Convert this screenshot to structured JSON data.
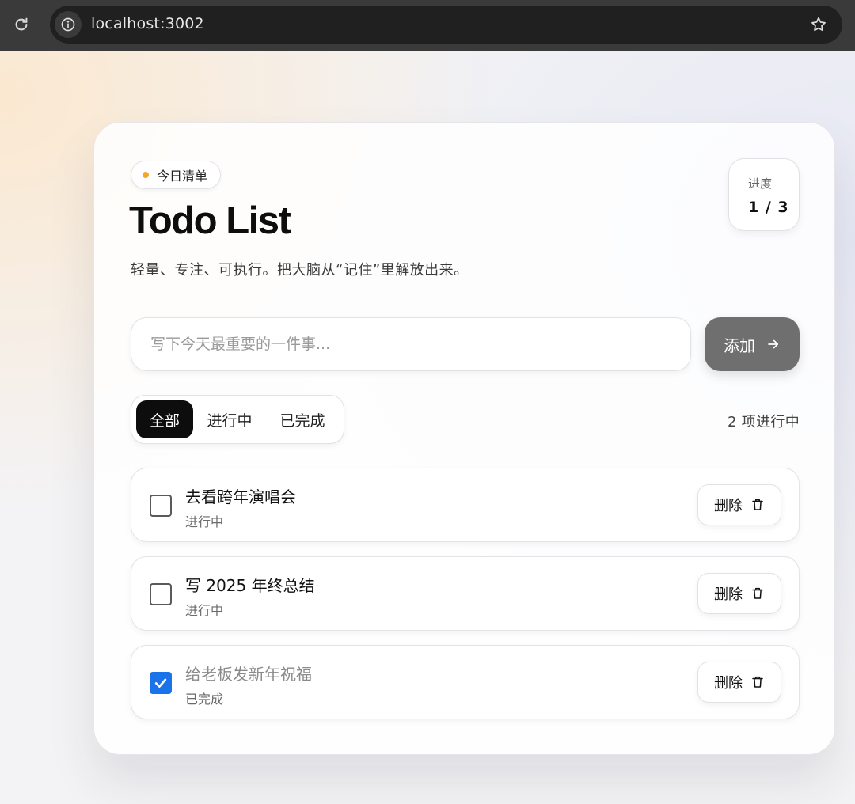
{
  "browser": {
    "url": "localhost:3002"
  },
  "app": {
    "badge": "今日清单",
    "title": "Todo List",
    "subtitle": "轻量、专注、可执行。把大脑从“记住”里解放出来。",
    "progress": {
      "label": "进度",
      "value": "1 / 3"
    },
    "input": {
      "placeholder": "写下今天最重要的一件事...",
      "value": ""
    },
    "add_button": "添加",
    "filters": [
      {
        "label": "全部",
        "active": true
      },
      {
        "label": "进行中",
        "active": false
      },
      {
        "label": "已完成",
        "active": false
      }
    ],
    "active_count": "2 项进行中",
    "delete_label": "删除",
    "tasks": [
      {
        "title": "去看跨年演唱会",
        "status": "进行中",
        "done": false
      },
      {
        "title": "写 2025 年终总结",
        "status": "进行中",
        "done": false
      },
      {
        "title": "给老板发新年祝福",
        "status": "已完成",
        "done": true
      }
    ]
  },
  "colors": {
    "accent": "#0d0d0d",
    "badge_dot": "#f5a623",
    "checkbox_checked": "#1a73e8",
    "add_button_bg": "#6f6f6f"
  },
  "icons": {
    "reload": "reload-icon",
    "info": "info-icon",
    "star": "star-icon",
    "arrow": "arrow-right-icon",
    "trash": "trash-icon",
    "check": "check-icon"
  }
}
